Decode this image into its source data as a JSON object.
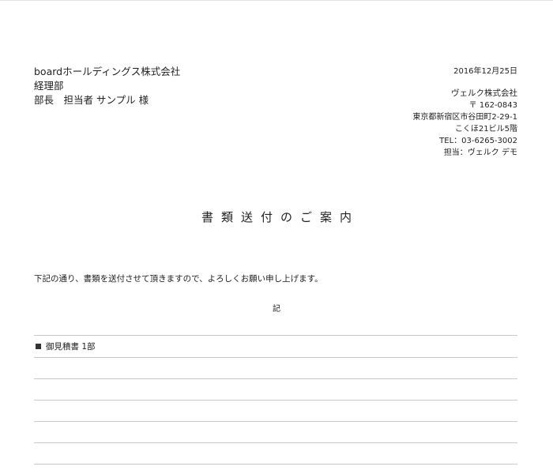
{
  "recipient": {
    "company": "boardホールディングス株式会社",
    "department": "経理部",
    "person": "部長　担当者 サンプル 様"
  },
  "issue_date": "2016年12月25日",
  "sender": {
    "company": "ヴェルク株式会社",
    "postal": "〒 162-0843",
    "address1": "東京都新宿区市谷田町2-29-1",
    "address2": "こくほ21ビル5階",
    "tel": "TEL：03-6265-3002",
    "contact": "担当：ヴェルク デモ"
  },
  "title": "書類送付のご案内",
  "intro": "下記の通り、書類を送付させて頂きますので、よろしくお願い申し上げます。",
  "ki": "記",
  "items": [
    "御見積書 1部",
    "",
    "",
    "",
    "",
    ""
  ],
  "colors": {
    "text": "#222222",
    "rule": "#c9c9c9",
    "bullet": "#333333"
  }
}
